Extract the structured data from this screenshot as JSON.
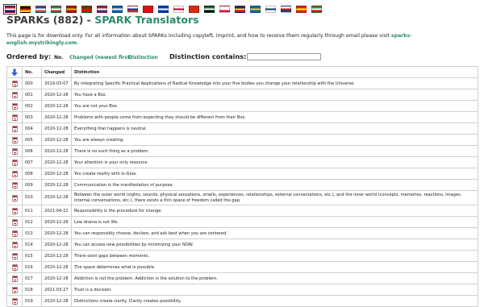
{
  "header": {
    "title_main": "SPARKs (882)",
    "title_sep": " - ",
    "title_sub": "SPARK Translators",
    "intro_text": "This page is for download only. For all information about SPARKs including copyleft, imprint, and how to receive them regularly through email please visit ",
    "intro_link": "sparks-english.mystrikingly.com",
    "intro_end": "."
  },
  "flags": [
    {
      "name": "flag-uk-icon",
      "colors": [
        "#c8102e",
        "#ffffff",
        "#012169"
      ]
    },
    {
      "name": "flag-germany-icon",
      "colors": [
        "#000000",
        "#dd0000",
        "#ffce00"
      ]
    },
    {
      "name": "flag-france-icon",
      "colors": [
        "#0055a4",
        "#ffffff",
        "#ef4135"
      ]
    },
    {
      "name": "flag-italy-icon",
      "colors": [
        "#009246",
        "#ffffff",
        "#ce2b37"
      ]
    },
    {
      "name": "flag-spain-icon",
      "colors": [
        "#aa151b",
        "#f1bf00",
        "#aa151b"
      ]
    },
    {
      "name": "flag-portugal-icon",
      "colors": [
        "#006600",
        "#ff0000",
        "#ff0000"
      ]
    },
    {
      "name": "flag-netherlands-icon",
      "colors": [
        "#ae1c28",
        "#ffffff",
        "#21468b"
      ]
    },
    {
      "name": "flag-greece-icon",
      "colors": [
        "#0d5eaf",
        "#ffffff",
        "#0d5eaf"
      ]
    },
    {
      "name": "flag-russia-icon",
      "colors": [
        "#ffffff",
        "#0039a6",
        "#d52b1e"
      ]
    },
    {
      "name": "flag-turkey-icon",
      "colors": [
        "#e30a17",
        "#e30a17",
        "#e30a17"
      ]
    },
    {
      "name": "flag-israel-icon",
      "colors": [
        "#0038b8",
        "#ffffff",
        "#0038b8"
      ]
    },
    {
      "name": "flag-japan-icon",
      "colors": [
        "#ffffff",
        "#bc002d",
        "#ffffff"
      ]
    },
    {
      "name": "flag-china-icon",
      "colors": [
        "#de2910",
        "#de2910",
        "#de2910"
      ]
    },
    {
      "name": "flag-uae-icon",
      "colors": [
        "#00732f",
        "#ffffff",
        "#000000"
      ]
    },
    {
      "name": "flag-poland-icon",
      "colors": [
        "#ffffff",
        "#ffffff",
        "#dc143c"
      ]
    },
    {
      "name": "flag-romania-icon",
      "colors": [
        "#002b7f",
        "#fcd116",
        "#ce1126"
      ]
    },
    {
      "name": "flag-sweden-icon",
      "colors": [
        "#006aa7",
        "#fecc00",
        "#006aa7"
      ]
    },
    {
      "name": "flag-finland-icon",
      "colors": [
        "#ffffff",
        "#003580",
        "#ffffff"
      ]
    },
    {
      "name": "flag-czech-icon",
      "colors": [
        "#ffffff",
        "#d7141a",
        "#11457e"
      ]
    },
    {
      "name": "flag-vietnam-icon",
      "colors": [
        "#da251d",
        "#ffff00",
        "#da251d"
      ]
    },
    {
      "name": "flag-iran-icon",
      "colors": [
        "#239f40",
        "#ffffff",
        "#da0000"
      ]
    }
  ],
  "controls": {
    "ordered_by_label": "Ordered by:",
    "sort_no": "No.",
    "sort_changed": "Changed (newest first)",
    "sort_distinction": "Distinction",
    "distinction_label": "Distinction contains:",
    "distinction_value": ""
  },
  "table": {
    "headers": {
      "no": "No.",
      "changed": "Changed",
      "distinction": "Distinction"
    },
    "rows": [
      {
        "no": "000",
        "changed": "2019-03-07",
        "distinction": "By integrating Specific Practical Applications of Radical Knowledge into your five bodies you change your relationship with the Universe."
      },
      {
        "no": "001",
        "changed": "2020-12-28",
        "distinction": "You have a Box."
      },
      {
        "no": "002",
        "changed": "2020-12-28",
        "distinction": "You are not your Box."
      },
      {
        "no": "003",
        "changed": "2020-12-28",
        "distinction": "Problems with people come from expecting they should be different from their Box."
      },
      {
        "no": "004",
        "changed": "2020-12-28",
        "distinction": "Everything that happens is neutral."
      },
      {
        "no": "005",
        "changed": "2020-12-28",
        "distinction": "You are always creating."
      },
      {
        "no": "006",
        "changed": "2020-12-28",
        "distinction": "There is no such thing as a problem."
      },
      {
        "no": "007",
        "changed": "2020-12-28",
        "distinction": "Your attention is your only resource."
      },
      {
        "no": "008",
        "changed": "2020-12-28",
        "distinction": "You create reality with Is-Glue."
      },
      {
        "no": "009",
        "changed": "2020-12-28",
        "distinction": "Communication is the manifestation of purpose."
      },
      {
        "no": "010",
        "changed": "2020-12-28",
        "distinction": "Between the outer world (sights, sounds, physical sensations, smells, experiences, relationships, external conversations, etc.), and the inner world (concepts, memories, reactions, images, internal conversations, etc.), there exists a thin space of freedom called the gap.",
        "tall": true
      },
      {
        "no": "011",
        "changed": "2021-04-21",
        "distinction": "Responsibility is the procedure for change."
      },
      {
        "no": "012",
        "changed": "2020-12-26",
        "distinction": "Low drama is not life."
      },
      {
        "no": "013",
        "changed": "2020-12-28",
        "distinction": "You can responsibly choose, declare, and ask best when you are centered."
      },
      {
        "no": "014",
        "changed": "2020-12-28",
        "distinction": "You can access new possibilities by minimizing your NOW."
      },
      {
        "no": "015",
        "changed": "2020-12-28",
        "distinction": "There exist gaps between moments."
      },
      {
        "no": "016",
        "changed": "2020-12-28",
        "distinction": "The space determines what is possible."
      },
      {
        "no": "017",
        "changed": "2020-12-28",
        "distinction": "Addiction is not the problem. Addiction is the solution to the problem."
      },
      {
        "no": "018",
        "changed": "2021-03-27",
        "distinction": "Trust is a decision."
      },
      {
        "no": "019",
        "changed": "2020-12-28",
        "distinction": "Distinctions create clarity. Clarity creates possibility."
      }
    ]
  }
}
